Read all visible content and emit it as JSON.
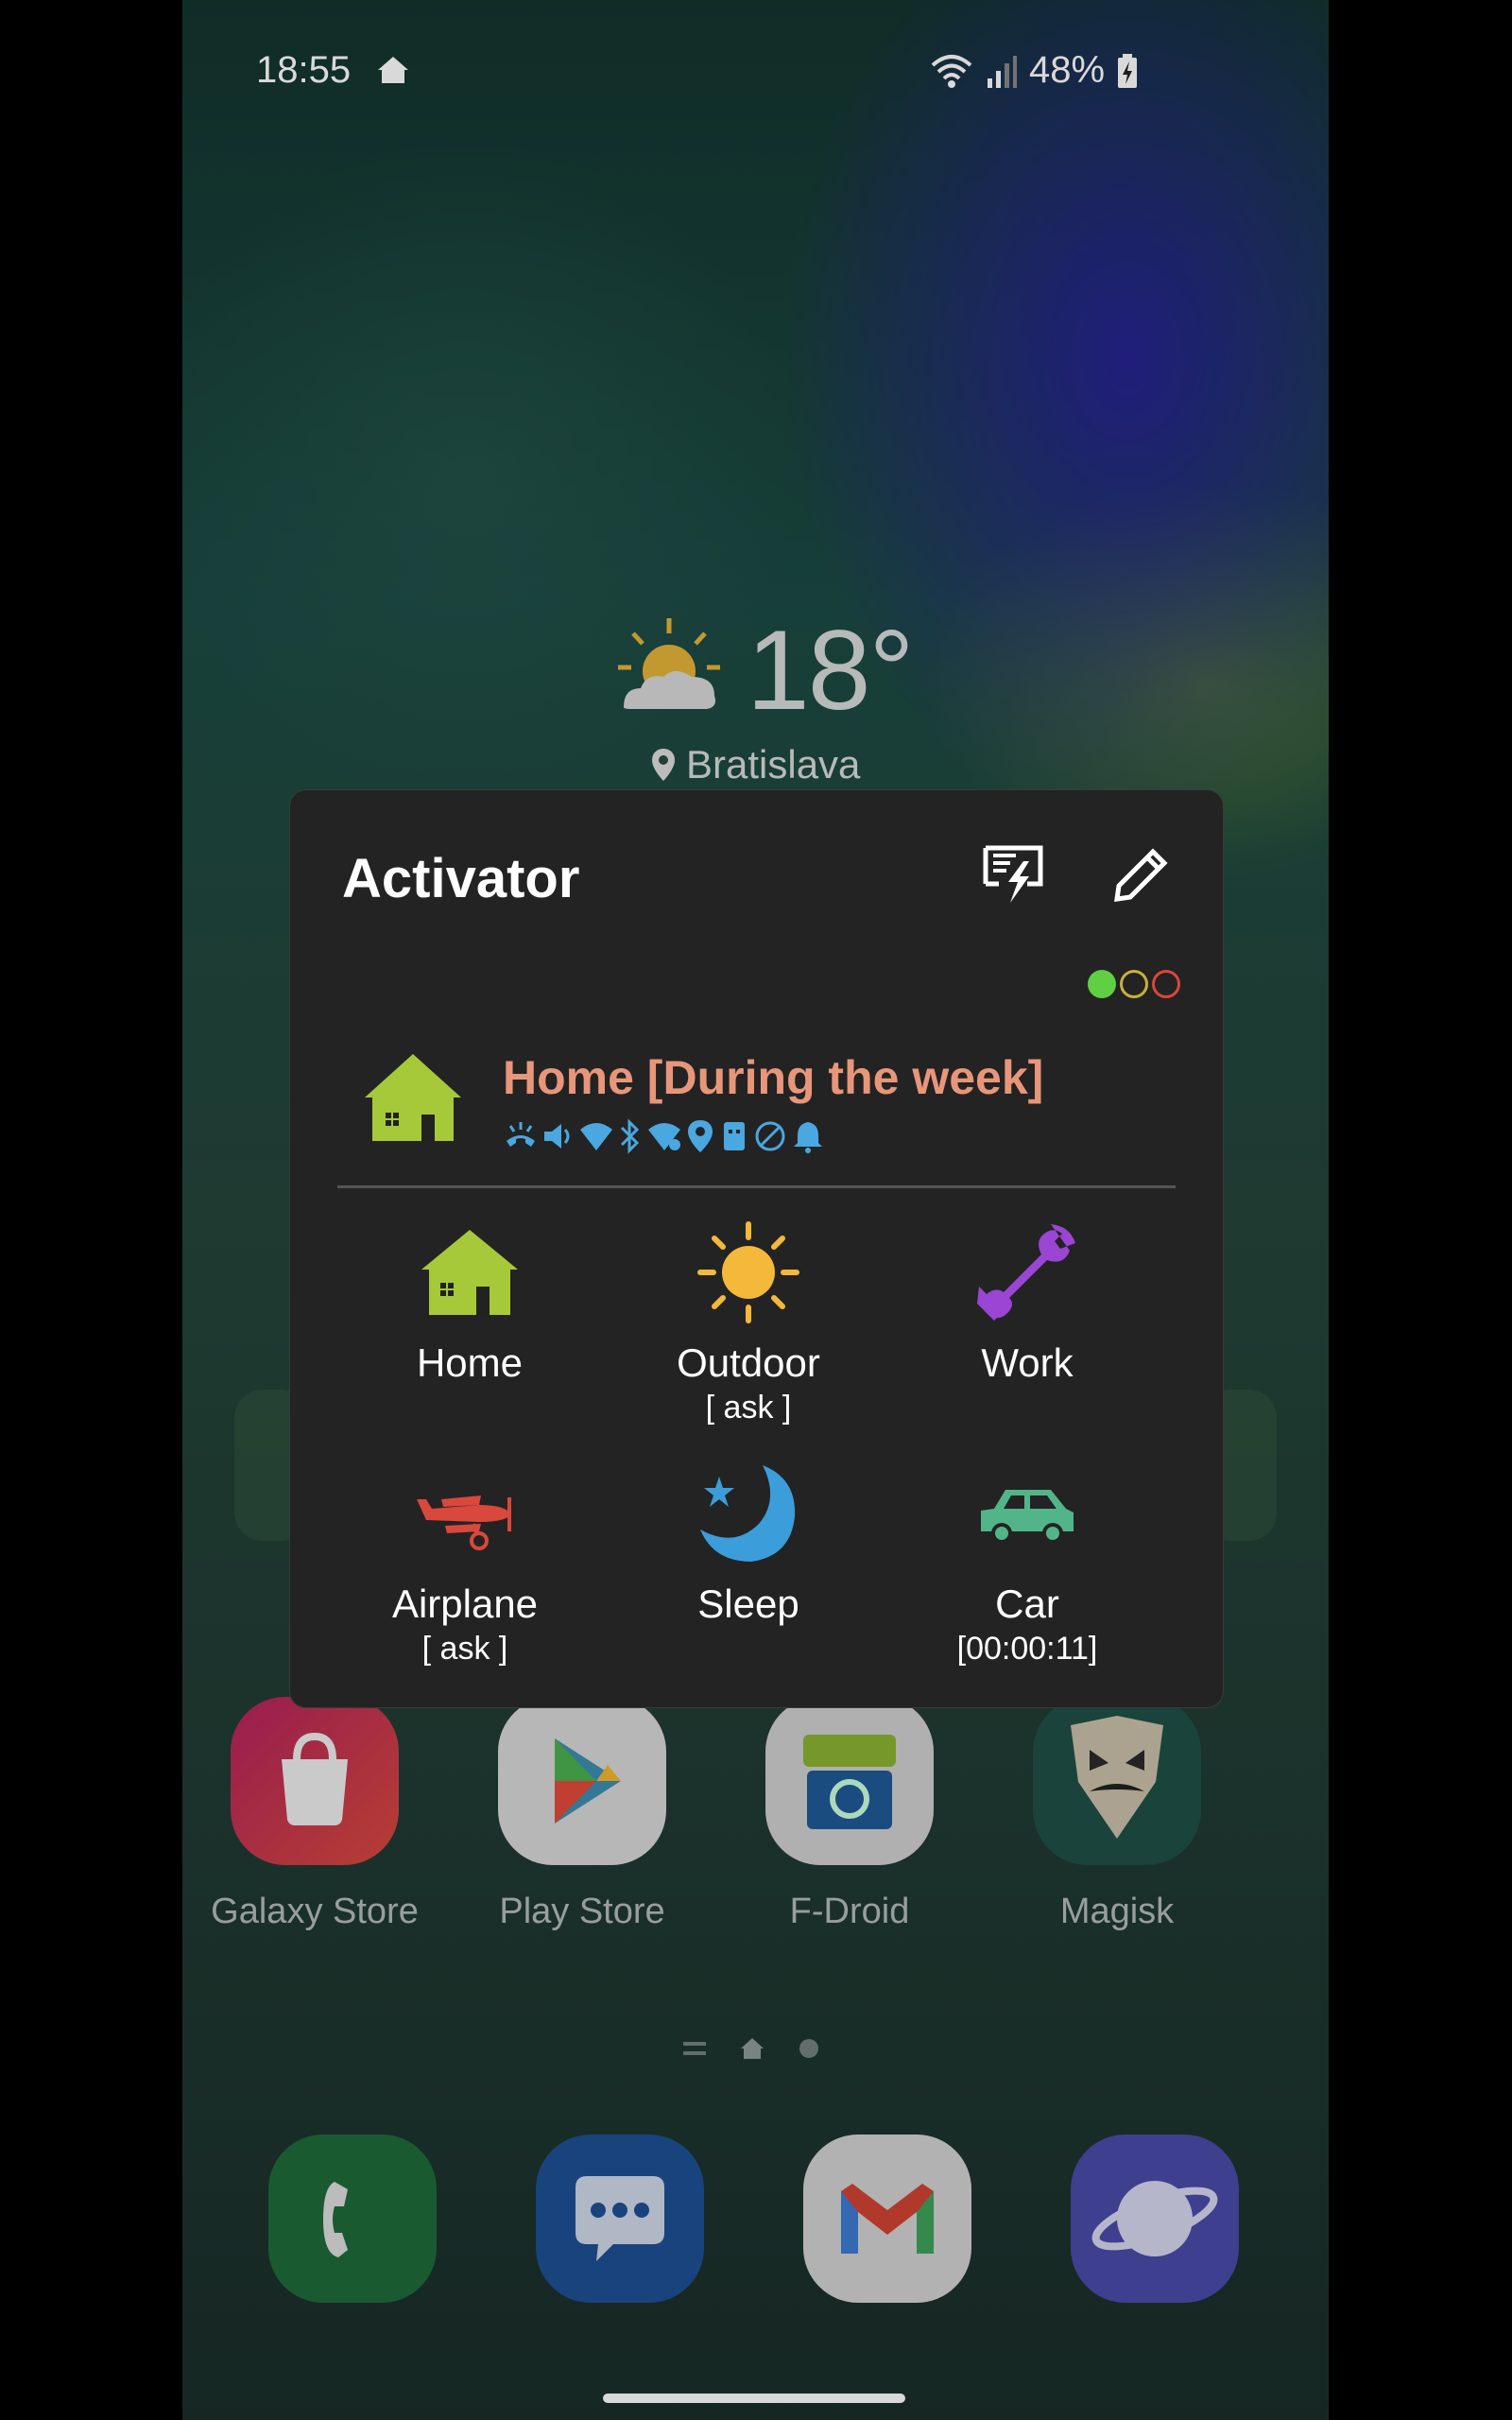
{
  "status_bar": {
    "time": "18:55",
    "battery": "48%"
  },
  "weather": {
    "temperature": "18°",
    "location": "Bratislava"
  },
  "apps": [
    {
      "label": "Galaxy Store"
    },
    {
      "label": "Play Store"
    },
    {
      "label": "F-Droid"
    },
    {
      "label": "Magisk"
    }
  ],
  "dock": [
    "Phone",
    "Messages",
    "Gmail",
    "Internet"
  ],
  "dialog": {
    "title": "Activator",
    "current_profile": {
      "name": "Home [During the week]"
    },
    "indicator_colors": [
      "#5fd043",
      "#c5b33a",
      "#d9463c"
    ],
    "profiles": [
      {
        "name": "Home",
        "sub": ""
      },
      {
        "name": "Outdoor",
        "sub": "[ ask ]"
      },
      {
        "name": "Work",
        "sub": ""
      },
      {
        "name": "Airplane",
        "sub": "[ ask ]"
      },
      {
        "name": "Sleep",
        "sub": ""
      },
      {
        "name": "Car",
        "sub": "[00:00:11]"
      }
    ]
  },
  "colors": {
    "accent_profile": "#e8967a",
    "home_green": "#a6c93a",
    "dialog_bg": "#232323"
  }
}
